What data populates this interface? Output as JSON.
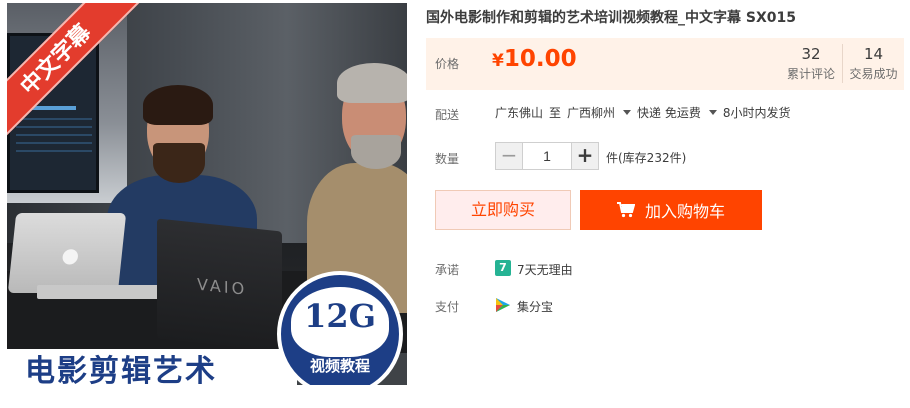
{
  "product_image": {
    "ribbon_text": "中文字幕",
    "badge_size": "12G",
    "badge_label": "视频教程",
    "caption": "电影剪辑艺术",
    "laptop_logo": "VAIO",
    "mac_logo": "",
    "colors": {
      "ribbon": "#e33c2d",
      "badge": "#1d3e86"
    }
  },
  "product": {
    "title": "国外电影制作和剪辑的艺术培训视频教程_中文字幕 SX015"
  },
  "price": {
    "label": "价格",
    "currency_symbol": "¥",
    "value": "10.00",
    "accent_color": "#ff4400"
  },
  "stats": [
    {
      "count": "32",
      "label": "累计评论"
    },
    {
      "count": "14",
      "label": "交易成功"
    }
  ],
  "delivery": {
    "label": "配送",
    "from": "广东佛山",
    "to_prefix": "至",
    "to": "广西柳州",
    "shipping": "快递 免运费",
    "dispatch": "8小时内发货"
  },
  "quantity": {
    "label": "数量",
    "value": "1",
    "minus": "−",
    "plus": "+",
    "stock_text": "件(库存232件)"
  },
  "buttons": {
    "buy_now": "立即购买",
    "add_to_cart": "加入购物车",
    "cart_icon": "cart-icon"
  },
  "promise": {
    "label": "承诺",
    "icon_glyph": "7",
    "text": "7天无理由"
  },
  "payment": {
    "label": "支付",
    "text": "集分宝"
  }
}
